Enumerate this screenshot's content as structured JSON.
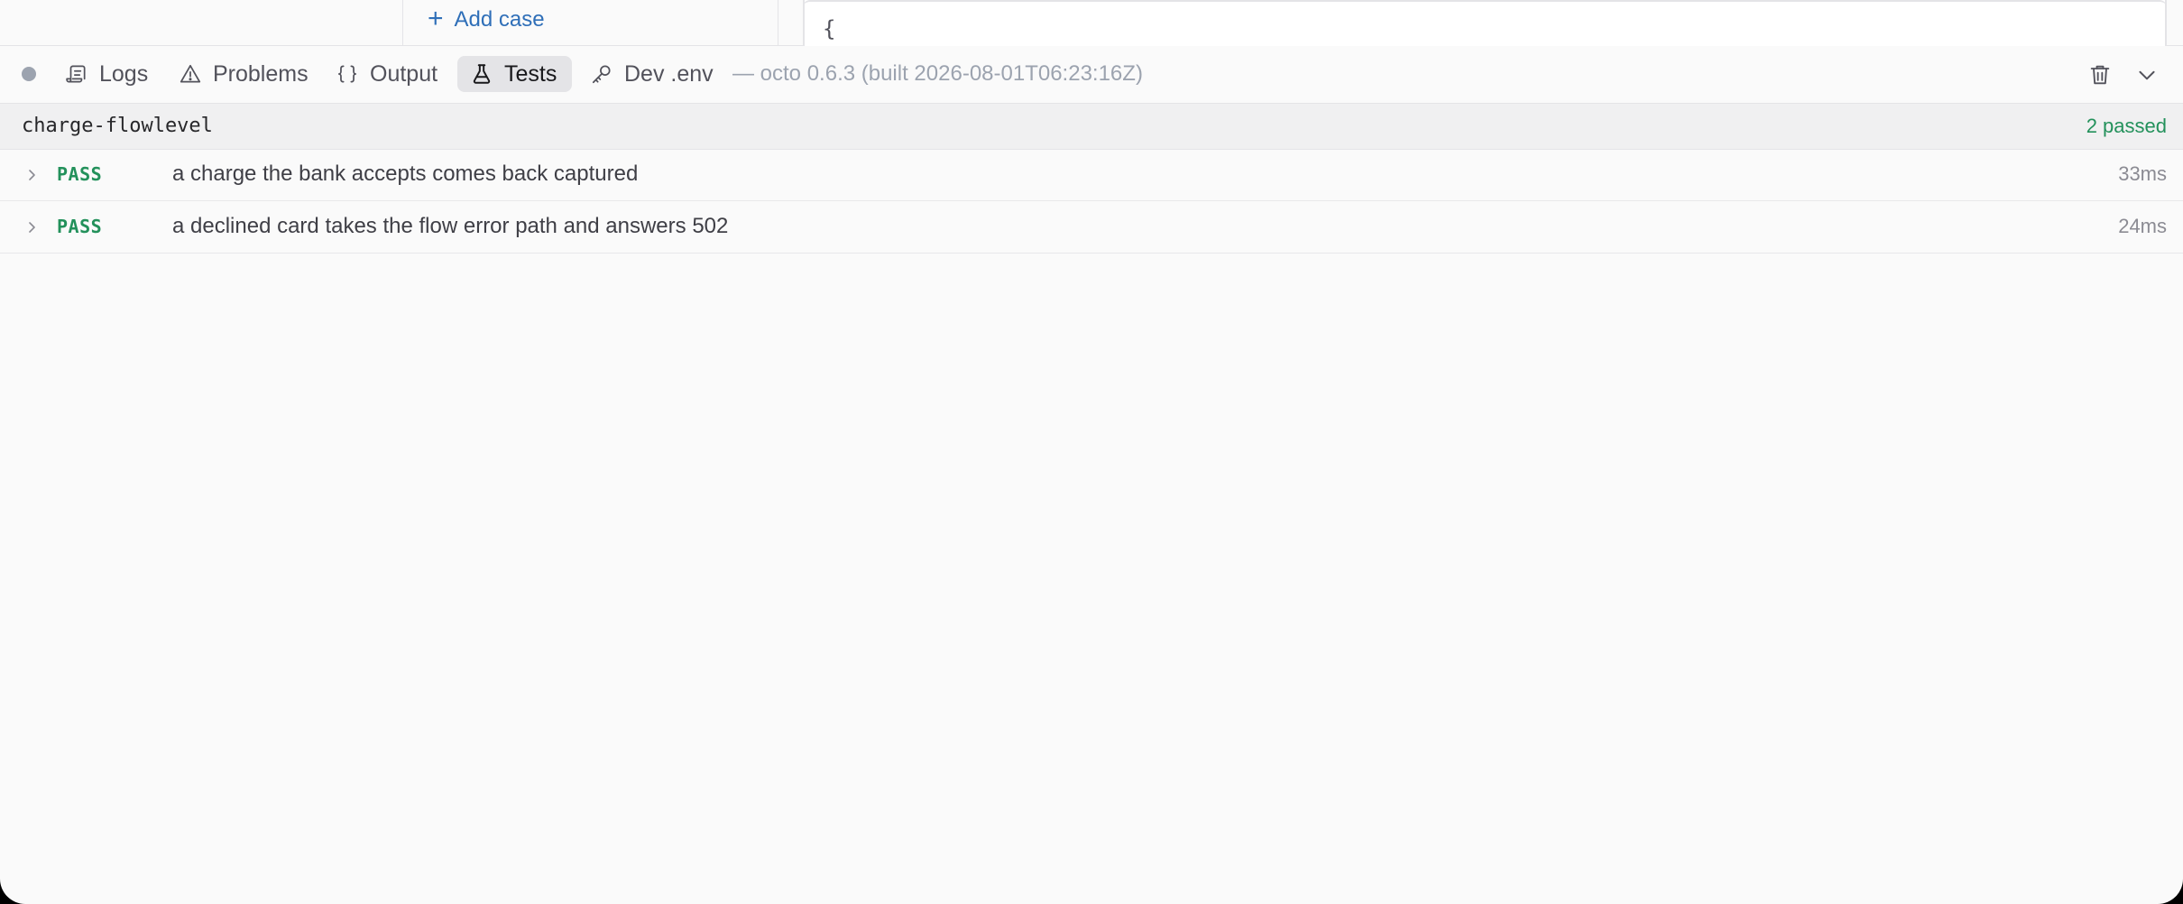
{
  "editor": {
    "add_case_label": "Add case",
    "json_preview": "{"
  },
  "panel": {
    "tabs": [
      {
        "label": "Logs",
        "icon": "scroll-icon",
        "active": false
      },
      {
        "label": "Problems",
        "icon": "warning-triangle-icon",
        "active": false
      },
      {
        "label": "Output",
        "icon": "braces-icon",
        "active": false
      },
      {
        "label": "Tests",
        "icon": "flask-icon",
        "active": true
      },
      {
        "label": "Dev .env",
        "icon": "key-icon",
        "active": false
      }
    ],
    "build_info": "— octo 0.6.3 (built 2026-08-01T06:23:16Z)",
    "actions": [
      "trash-icon",
      "chevron-down-icon"
    ]
  },
  "suite": {
    "name": "charge-flowlevel",
    "summary": "2 passed",
    "tests": [
      {
        "status": "PASS",
        "title": "a charge the bank accepts comes back captured",
        "duration": "33ms"
      },
      {
        "status": "PASS",
        "title": "a declined card takes the flow error path and answers 502",
        "duration": "24ms"
      }
    ]
  },
  "colors": {
    "pass": "#23915b",
    "link": "#2f6fb8",
    "active_tab_bg": "#e4e4e7"
  }
}
